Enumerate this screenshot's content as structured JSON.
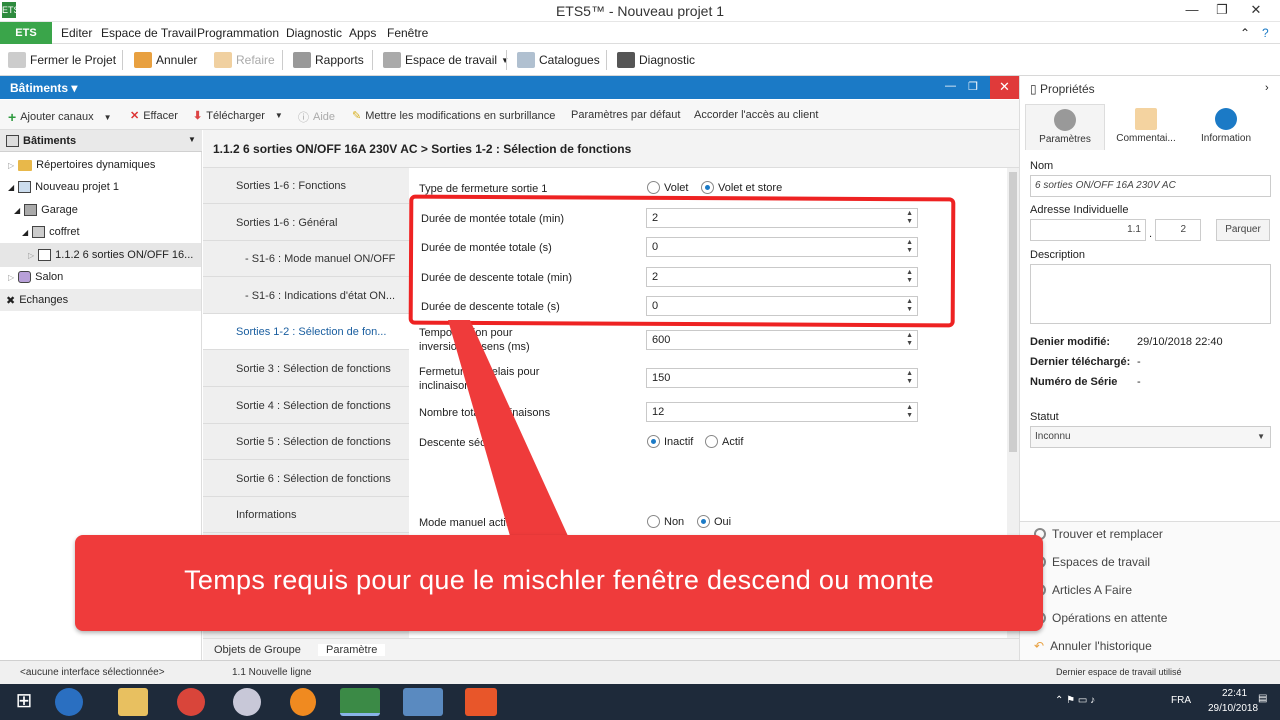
{
  "window": {
    "title": "ETS5™ - Nouveau projet 1",
    "app_icon": "ETS"
  },
  "menu": {
    "ets": "ETS",
    "items": [
      "Editer",
      "Espace de Travail",
      "Programmation",
      "Diagnostic",
      "Apps",
      "Fenêtre"
    ]
  },
  "toolbar": {
    "close_project": "Fermer le Projet",
    "undo": "Annuler",
    "redo": "Refaire",
    "reports": "Rapports",
    "workspace": "Espace de travail",
    "catalogs": "Catalogues",
    "diagnostic": "Diagnostic"
  },
  "panel": {
    "title": "Bâtiments"
  },
  "toolbar2": {
    "add_channels": "Ajouter canaux",
    "delete": "Effacer",
    "download": "Télécharger",
    "help": "Aide",
    "highlight": "Mettre les modifications en surbrillance",
    "defaults": "Paramètres par défaut",
    "client_access": "Accorder l'accès au client"
  },
  "tree": {
    "header": "Bâtiments",
    "dynamic_folders": "Répertoires dynamiques",
    "project": "Nouveau projet 1",
    "garage": "Garage",
    "coffret": "coffret",
    "device": "1.1.2 6 sorties ON/OFF 16...",
    "salon": "Salon",
    "exchanges": "Echanges"
  },
  "breadcrumb": "1.1.2 6 sorties ON/OFF 16A 230V AC > Sorties 1-2 : Sélection de fonctions",
  "param_tabs": [
    "Sorties 1-6 : Fonctions",
    "Sorties 1-6 : Général",
    "- S1-6 : Mode manuel ON/OFF",
    "- S1-6 : Indications d'état ON...",
    "Sorties 1-2 : Sélection de fon...",
    "Sortie 3 : Sélection de fonctions",
    "Sortie 4 : Sélection de fonctions",
    "Sortie 5 : Sélection de fonctions",
    "Sortie 6 : Sélection de fonctions",
    "Informations"
  ],
  "params": {
    "closing_type_label": "Type de fermeture sortie 1",
    "closing_opt1": "Volet",
    "closing_opt2": "Volet et store",
    "up_min_label": "Durée de montée totale (min)",
    "up_min": "2",
    "up_s_label": "Durée de montée totale (s)",
    "up_s": "0",
    "down_min_label": "Durée de descente totale (min)",
    "down_min": "2",
    "down_s_label": "Durée de descente totale (s)",
    "down_s": "0",
    "tempo_label_1": "Temporisation pour",
    "tempo_label_2": "inversion de sens (ms)",
    "tempo": "600",
    "relay_label_1": "Fermeture du relais pour",
    "relay_label_2": "inclinaison (ms)",
    "relay": "150",
    "tilt_label": "Nombre total d'inclinaisons",
    "tilt": "12",
    "safe_down_label": "Descente sécurité",
    "safe_opt1": "Inactif",
    "safe_opt2": "Actif",
    "manual_label": "Mode manuel actif sortie 1",
    "manual_opt1": "Non",
    "manual_opt2": "Oui"
  },
  "bottom_tabs": [
    "Objets de Groupe",
    "Paramètre"
  ],
  "status": {
    "interface": "<aucune interface sélectionnée>",
    "line": "1.1 Nouvelle ligne",
    "workspace": "Dernier espace de travail utilisé"
  },
  "properties": {
    "title": "Propriétés",
    "tabs": [
      "Paramètres",
      "Commentai...",
      "Information"
    ],
    "name_label": "Nom",
    "name_value": "6 sorties ON/OFF 16A 230V AC",
    "address_label": "Adresse Individuelle",
    "address_prefix": "1.1",
    "address_num": "2",
    "park_button": "Parquer",
    "description_label": "Description",
    "last_modified_label": "Denier modifié:",
    "last_modified": "29/10/2018 22:40",
    "last_downloaded_label": "Dernier téléchargé:",
    "last_downloaded": "-",
    "serial_label": "Numéro de Série",
    "serial": "-",
    "status_label": "Statut",
    "status_value": "Inconnu",
    "links": [
      "Trouver et remplacer",
      "Espaces de travail",
      "Articles A Faire",
      "Opérations en attente",
      "Annuler l'historique"
    ]
  },
  "banner": "Temps requis pour que le mischler fenêtre  descend ou monte",
  "taskbar": {
    "lang": "FRA",
    "time": "22:41",
    "date": "29/10/2018"
  },
  "colors": {
    "ets_green": "#3aa54a",
    "panel_blue": "#1b7ac6",
    "annotation_red": "#ef3b3b"
  }
}
